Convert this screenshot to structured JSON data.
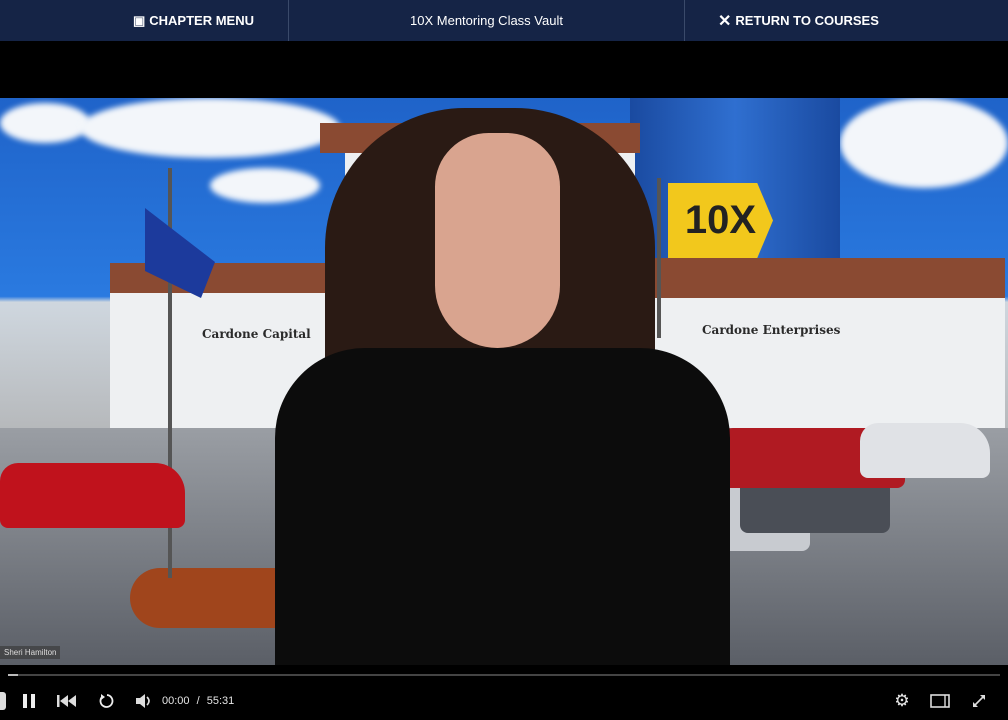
{
  "topbar": {
    "chapter_menu": "CHAPTER MENU",
    "title": "10X Mentoring Class Vault",
    "return": "RETURN TO COURSES"
  },
  "video": {
    "speaker_name": "Sheri Hamilton",
    "scene_text": {
      "flag": "10X",
      "sign_left": "Cardone Capital",
      "sign_right": "Cardone Enterprises"
    },
    "progress_fraction": 0.0
  },
  "player": {
    "current_time": "00:00",
    "separator": "/",
    "duration": "55:31"
  }
}
